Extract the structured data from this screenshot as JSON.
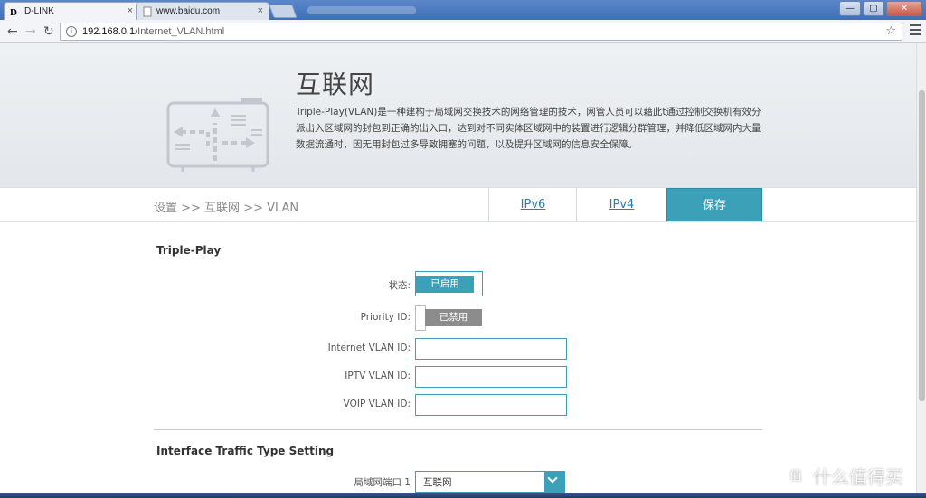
{
  "browser": {
    "tabs": [
      {
        "title": "D-LINK"
      },
      {
        "title": "www.baidu.com"
      }
    ],
    "address": {
      "host": "192.168.0.1",
      "path": "/Internet_VLAN.html"
    },
    "window_controls": {
      "minimize": "—",
      "maximize": "▢",
      "close": "✕"
    }
  },
  "hero": {
    "title": "互联网",
    "description": "Triple-Play(VLAN)是一种建构于局域网交换技术的网络管理的技术，网管人员可以藉此t通过控制交换机有效分派出入区域网的封包到正确的出入口，达到对不同实体区域网中的装置进行逻辑分群管理，并降低区域网内大量数据流通时，因无用封包过多导致拥塞的问题，以及提升区域网的信息安全保障。"
  },
  "subnav": {
    "breadcrumb": "设置 >> 互联网 >> VLAN",
    "tab_ipv6": "IPv6",
    "tab_ipv4": "IPv4",
    "save": "保存"
  },
  "triple_play": {
    "section_title": "Triple-Play",
    "status_label": "状态:",
    "status_value": "已启用",
    "priority_label": "Priority ID:",
    "priority_value": "已禁用",
    "internet_vlan_label": "Internet VLAN ID:",
    "iptv_vlan_label": "IPTV VLAN ID:",
    "voip_vlan_label": "VOIP VLAN ID:"
  },
  "interface": {
    "section_title": "Interface Traffic Type Setting",
    "lan_port1_label": "局域网端口 1",
    "lan_port1_value": "互联网"
  },
  "watermark": {
    "text": "什么值得买",
    "mark": "值"
  },
  "colors": {
    "accent": "#3ba0b8",
    "disabled": "#8c8c8c"
  }
}
